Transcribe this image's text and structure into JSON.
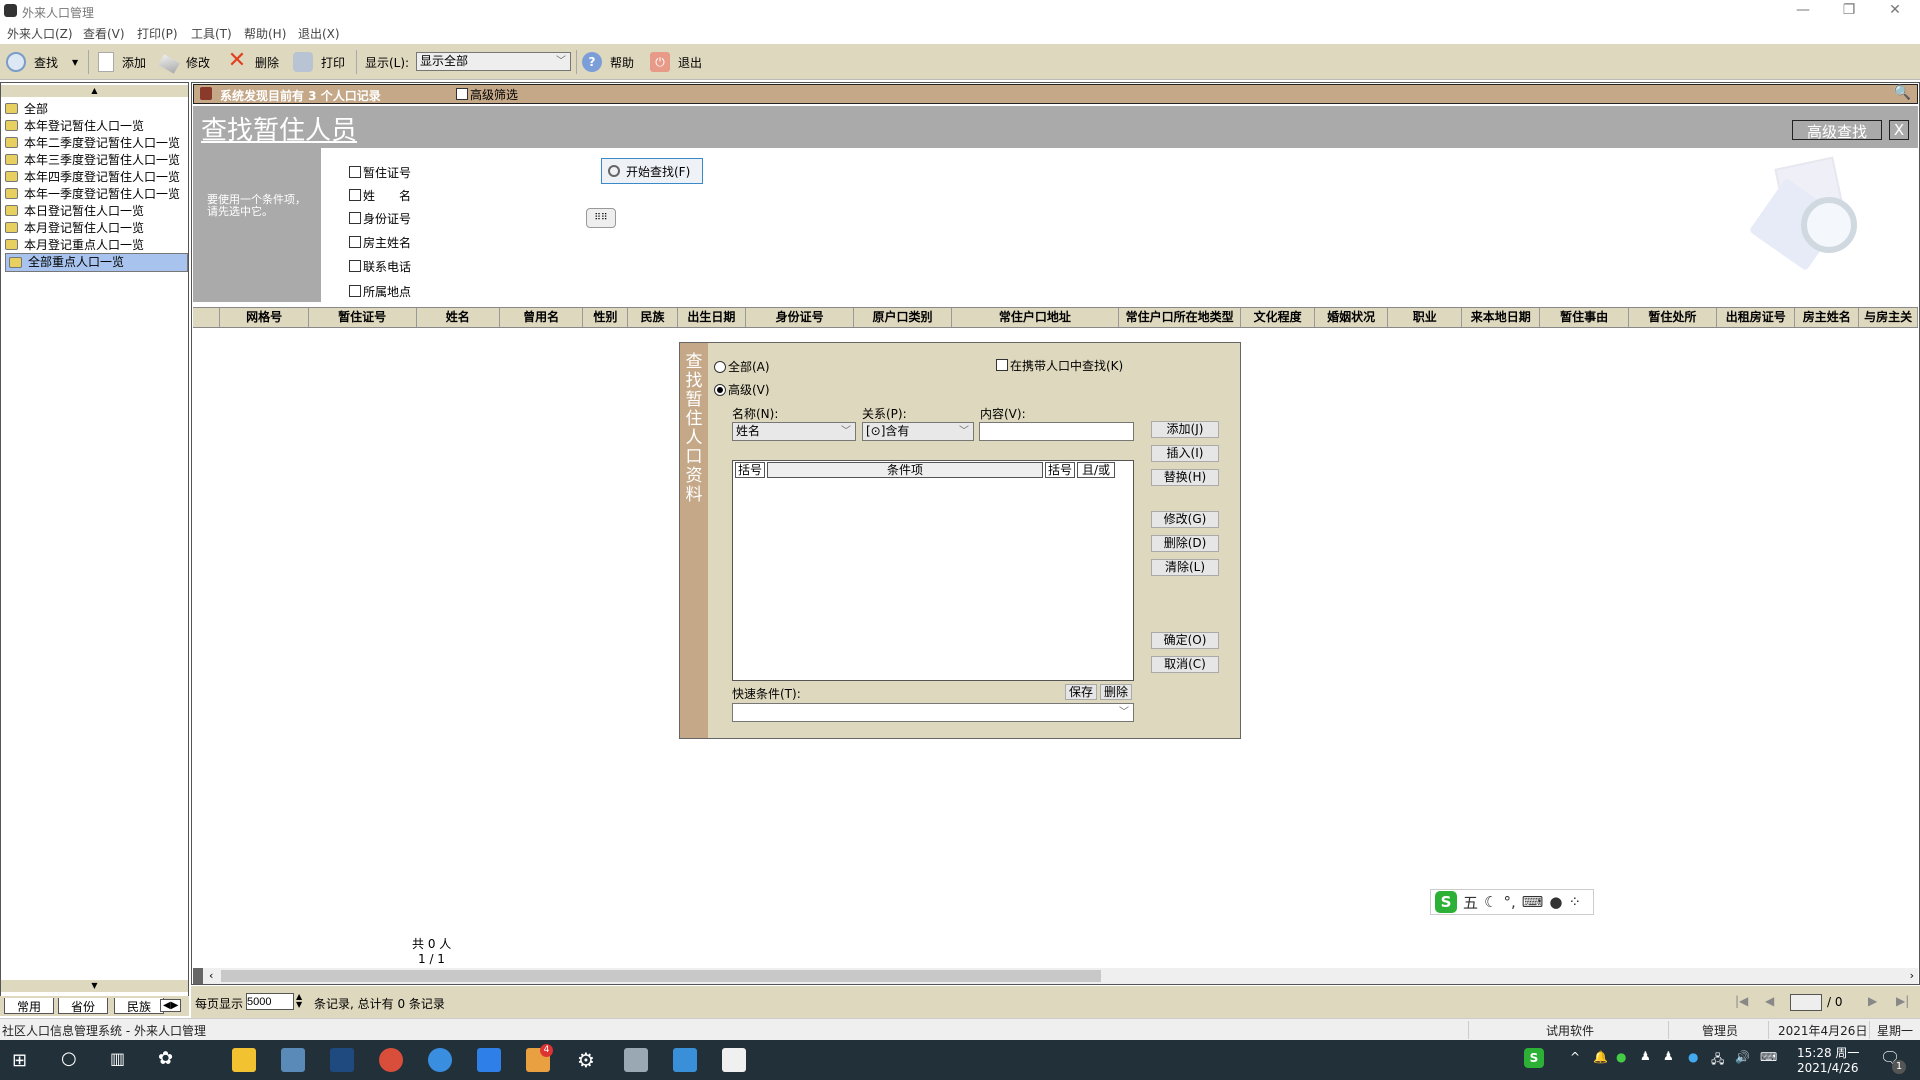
{
  "window": {
    "title": "外来人口管理",
    "minimize": "—",
    "restore": "❐",
    "close": "✕"
  },
  "menu": [
    "外来人口(Z)",
    "查看(V)",
    "打印(P)",
    "工具(T)",
    "帮助(H)",
    "退出(X)"
  ],
  "toolbar": {
    "find": "查找",
    "add": "添加",
    "edit": "修改",
    "delete": "删除",
    "print": "打印",
    "display_label": "显示(L):",
    "display_value": "显示全部",
    "help": "帮助",
    "exit": "退出"
  },
  "sidebar": {
    "items": [
      "全部",
      "本年登记暂住人口一览",
      "本年二季度登记暂住人口一览",
      "本年三季度登记暂住人口一览",
      "本年四季度登记暂住人口一览",
      "本年一季度登记暂住人口一览",
      "本日登记暂住人口一览",
      "本月登记暂住人口一览",
      "本月登记重点人口一览",
      "全部重点人口一览"
    ],
    "selected_index": 9,
    "tabs": [
      "常用",
      "省份",
      "民族"
    ]
  },
  "infobar": {
    "message": "系统发现目前有 3 个人口记录",
    "advanced_filter": "高级筛选"
  },
  "banner": {
    "title": "查找暂住人员",
    "advanced_search": "高级查找",
    "close": "X"
  },
  "search": {
    "hint": "要使用一个条件项，请先选中它。",
    "fields": [
      "暂住证号",
      "姓　　名",
      "身份证号",
      "房主姓名",
      "联系电话",
      "所属地点"
    ],
    "start_button": "开始查找(F)"
  },
  "table": {
    "columns": [
      "网格号",
      "暂住证号",
      "姓名",
      "曾用名",
      "性别",
      "民族",
      "出生日期",
      "身份证号",
      "原户口类别",
      "常住户口地址",
      "常住户口所在地类型",
      "文化程度",
      "婚姻状况",
      "职业",
      "来本地日期",
      "暂住事由",
      "暂住处所",
      "出租房证号",
      "房主姓名",
      "与房主关"
    ],
    "count_text": "共 0 人",
    "page_text": "1 / 1"
  },
  "dialog": {
    "vertical_title": "查找暂住人口资料",
    "radio_all": "全部(A)",
    "radio_advanced": "高级(V)",
    "radio_selected": "advanced",
    "carry_check": "在携带人口中查找(K)",
    "name_label": "名称(N):",
    "name_value": "姓名",
    "relation_label": "关系(P):",
    "relation_value": "[⊙]含有",
    "content_label": "内容(V):",
    "content_value": "",
    "grid_headers": [
      "括号",
      "条件项",
      "括号",
      "且/或"
    ],
    "buttons": {
      "add": "添加(J)",
      "insert": "插入(I)",
      "replace": "替换(H)",
      "modify": "修改(G)",
      "delete": "删除(D)",
      "clear": "清除(L)",
      "ok": "确定(O)",
      "cancel": "取消(C)"
    },
    "quick_label": "快速条件(T):",
    "quick_save": "保存",
    "quick_delete": "删除",
    "quick_value": ""
  },
  "pager": {
    "per_page_label": "每页显示",
    "per_page_value": "5000",
    "summary": "条记录, 总计有 0 条记录",
    "page_input": "",
    "page_total": "/ 0"
  },
  "statusbar": {
    "app": "社区人口信息管理系统 - 外来人口管理",
    "trial": "试用软件",
    "user": "管理员",
    "date": "2021年4月26日",
    "weekday": "星期一"
  },
  "ime": {
    "mode": "五"
  },
  "taskbar": {
    "time": "15:28 周一",
    "date": "2021/4/26",
    "notifications": "1",
    "badge": "4"
  }
}
